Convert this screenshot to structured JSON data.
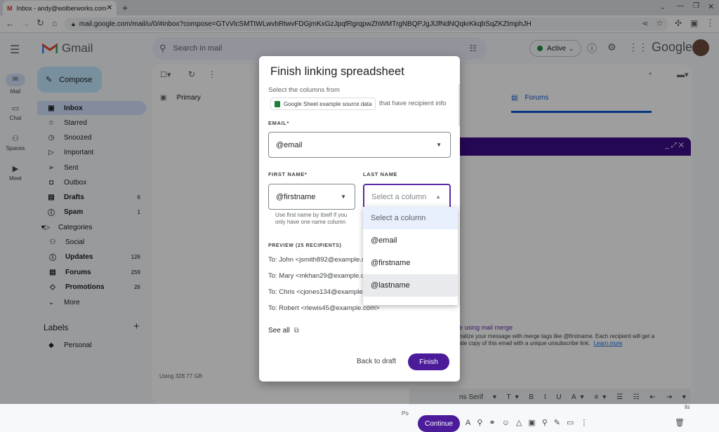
{
  "browser": {
    "tab_title": "Inbox - andy@wolberworks.com",
    "url": "mail.google.com/mail/u/0/#inbox?compose=GTvVlcSMTtWLwvbRtwvFDGjmKxGzJpqfRgrqpwZhWMTrgNBQPJgJlJfNdNQqkrKkqbSqZKZtmphJH"
  },
  "gmail": {
    "logo": "Gmail",
    "search_placeholder": "Search in mail",
    "status": "Active",
    "brand": "Google",
    "rail": [
      "Mail",
      "Chat",
      "Spaces",
      "Meet"
    ],
    "compose": "Compose",
    "nav": [
      {
        "label": "Inbox",
        "count": "",
        "icon": "inbox-icon"
      },
      {
        "label": "Starred",
        "count": "",
        "icon": "star-icon"
      },
      {
        "label": "Snoozed",
        "count": "",
        "icon": "clock-icon"
      },
      {
        "label": "Important",
        "count": "",
        "icon": "important-icon"
      },
      {
        "label": "Sent",
        "count": "",
        "icon": "send-icon"
      },
      {
        "label": "Outbox",
        "count": "",
        "icon": "outbox-icon"
      },
      {
        "label": "Drafts",
        "count": "6",
        "icon": "draft-icon"
      },
      {
        "label": "Spam",
        "count": "1",
        "icon": "spam-icon"
      },
      {
        "label": "Categories",
        "count": "",
        "icon": "label-icon"
      },
      {
        "label": "Social",
        "count": "",
        "icon": "people-icon"
      },
      {
        "label": "Updates",
        "count": "126",
        "icon": "info-icon"
      },
      {
        "label": "Forums",
        "count": "259",
        "icon": "forum-icon"
      },
      {
        "label": "Promotions",
        "count": "26",
        "icon": "tag-icon"
      },
      {
        "label": "More",
        "count": "",
        "icon": "chevron-down-icon"
      }
    ],
    "labels_heading": "Labels",
    "labels": [
      "Personal"
    ],
    "storage": "Using 328.77 GB",
    "tabs": {
      "primary": "Primary",
      "forums": "Forums"
    },
    "compose_window": {
      "mail_merge_title": "e using mail merge",
      "mail_merge_line1": "nalize your message with merge tags like @firstname. Each recipient will get a",
      "mail_merge_line2": "ate copy of this email with a unique unsubscribe link.",
      "learn_more": "Learn more",
      "font": "ns Serif",
      "continue": "Continue",
      "fragment_po": "Po",
      "fragment_ils": "ils"
    }
  },
  "dialog": {
    "title": "Finish linking spreadsheet",
    "select_prefix": "Select the columns from",
    "sheet_name": "Google Sheet example source data",
    "select_suffix": "that have recipient info",
    "email_label": "EMAIL*",
    "email_value": "@email",
    "first_name_label": "FIRST NAME*",
    "first_name_value": "@firstname",
    "first_name_hint_1": "Use first name by itself if you",
    "first_name_hint_2": "only have one name column",
    "last_name_label": "LAST NAME",
    "last_name_placeholder": "Select a column",
    "preview_label": "PREVIEW (25 RECIPIENTS)",
    "preview": [
      "To: John <jsmith892@example.com>",
      "To: Mary <mkhan29@example.com>",
      "To: Chris <cjones134@example.com>",
      "To: Robert <rlewis45@example.com>"
    ],
    "see_all": "See all",
    "back": "Back to draft",
    "finish": "Finish"
  },
  "dropdown": {
    "options": [
      "Select a column",
      "@email",
      "@firstname",
      "@lastname"
    ]
  },
  "colors": {
    "accent": "#5b2aa6",
    "finish": "#4b1b9a",
    "selected": "#e8f0fe"
  }
}
